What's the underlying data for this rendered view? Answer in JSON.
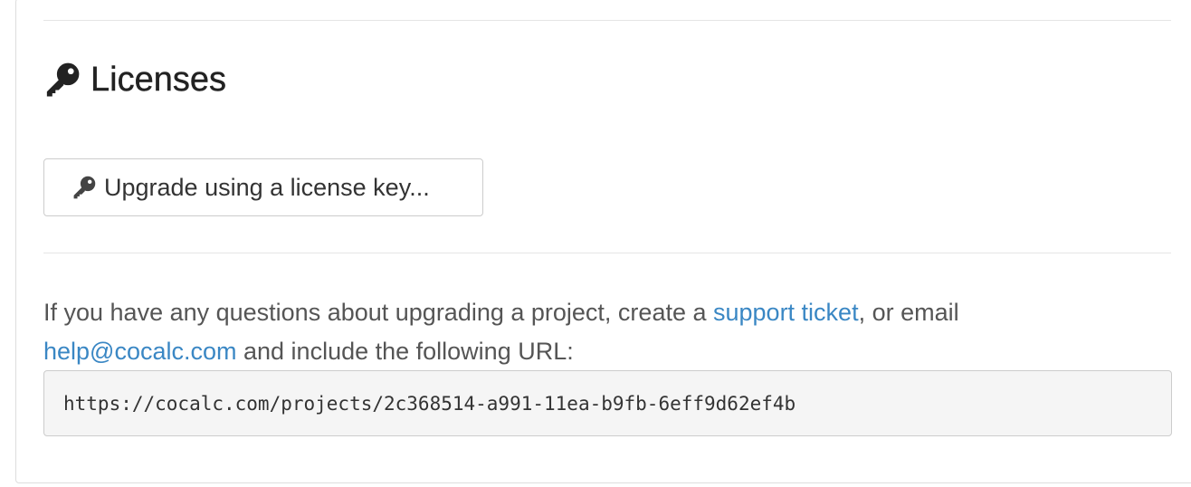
{
  "licenses": {
    "heading_icon": "key-icon",
    "heading": "Licenses",
    "upgrade_button": {
      "icon": "key-icon",
      "label": "Upgrade using a license key..."
    }
  },
  "help": {
    "text_before_link": "If you have any questions about upgrading a project, create a ",
    "support_link": "support ticket",
    "text_after_support": ", or email",
    "email_link": "help@cocalc.com",
    "text_after_email": " and include the following URL:",
    "project_url": "https://cocalc.com/projects/2c368514-a991-11ea-b9fb-6eff9d62ef4b"
  },
  "colors": {
    "link": "#3a87c4",
    "text": "#555555",
    "heading": "#222222",
    "url_box_bg": "#f5f5f5"
  }
}
